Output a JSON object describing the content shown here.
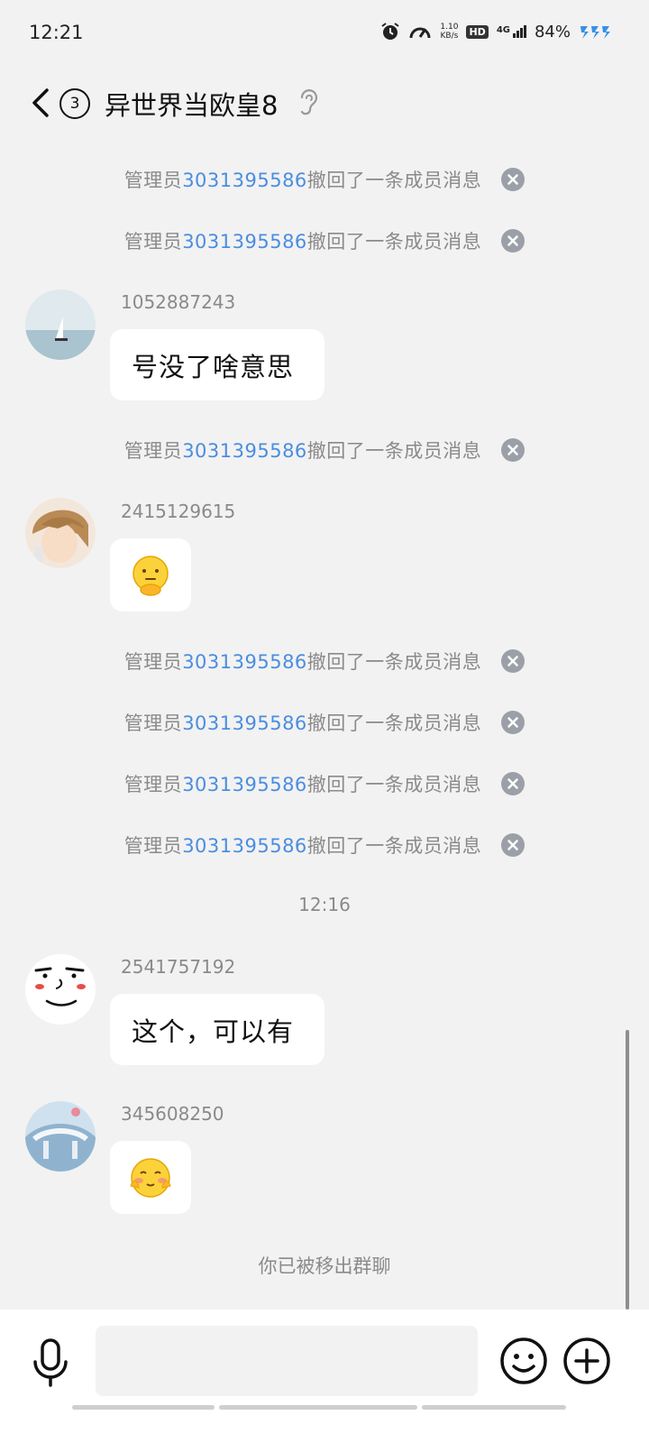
{
  "status_bar": {
    "time": "12:21",
    "speed_value": "1.10",
    "speed_unit": "KB/s",
    "hd": "HD",
    "network": "4G",
    "battery": "84%"
  },
  "header": {
    "unread_count": "3",
    "title": "异世界当欧皇8"
  },
  "recall_notice": {
    "prefix": "管理员",
    "admin_id": "3031395586",
    "suffix": "撤回了一条成员消息"
  },
  "messages": [
    {
      "user": "1052887243",
      "text": "号没了啥意思"
    },
    {
      "user": "2415129615",
      "emoji": "thinking-emoji"
    },
    {
      "user": "2541757192",
      "text": "这个，可以有"
    },
    {
      "user": "345608250",
      "emoji": "blushing-emoji"
    }
  ],
  "timestamp": "12:16",
  "removed_notice": "你已被移出群聊",
  "input": {
    "placeholder": "",
    "value": ""
  },
  "colors": {
    "link": "#4b8de0",
    "background": "#f2f2f2",
    "bubble": "#ffffff"
  }
}
